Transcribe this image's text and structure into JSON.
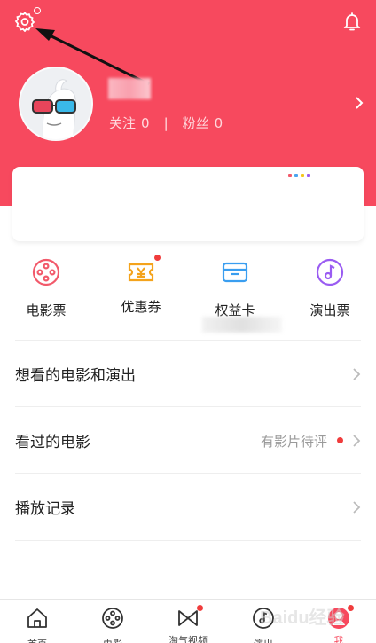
{
  "header": {
    "settings_icon": "gear-icon",
    "notification_icon": "bell-icon",
    "bg_color": "#f7495e"
  },
  "profile": {
    "follow_label": "关注",
    "follow_count": "0",
    "separator": "|",
    "fans_label": "粉丝",
    "fans_count": "0"
  },
  "shortcuts": [
    {
      "label": "电影票",
      "icon": "film-reel-icon",
      "color": "#f25a6b",
      "badge": false
    },
    {
      "label": "优惠券",
      "icon": "coupon-icon",
      "color": "#f4a31c",
      "badge": true
    },
    {
      "label": "权益卡",
      "icon": "card-icon",
      "color": "#3a9ef0",
      "badge": false
    },
    {
      "label": "演出票",
      "icon": "music-disc-icon",
      "color": "#9a5cf2",
      "badge": false
    }
  ],
  "list": [
    {
      "title": "想看的电影和演出",
      "sub": ""
    },
    {
      "title": "看过的电影",
      "sub": "有影片待评"
    },
    {
      "title": "播放记录",
      "sub": ""
    }
  ],
  "tabbar": [
    {
      "label": "首页",
      "icon": "home-icon"
    },
    {
      "label": "电影",
      "icon": "film-reel-icon"
    },
    {
      "label": "淘气视频",
      "icon": "video-bowtie-icon"
    },
    {
      "label": "演出",
      "icon": "music-disc-icon"
    },
    {
      "label": "我",
      "icon": "profile-icon"
    }
  ],
  "watermark": "Baidu经验"
}
